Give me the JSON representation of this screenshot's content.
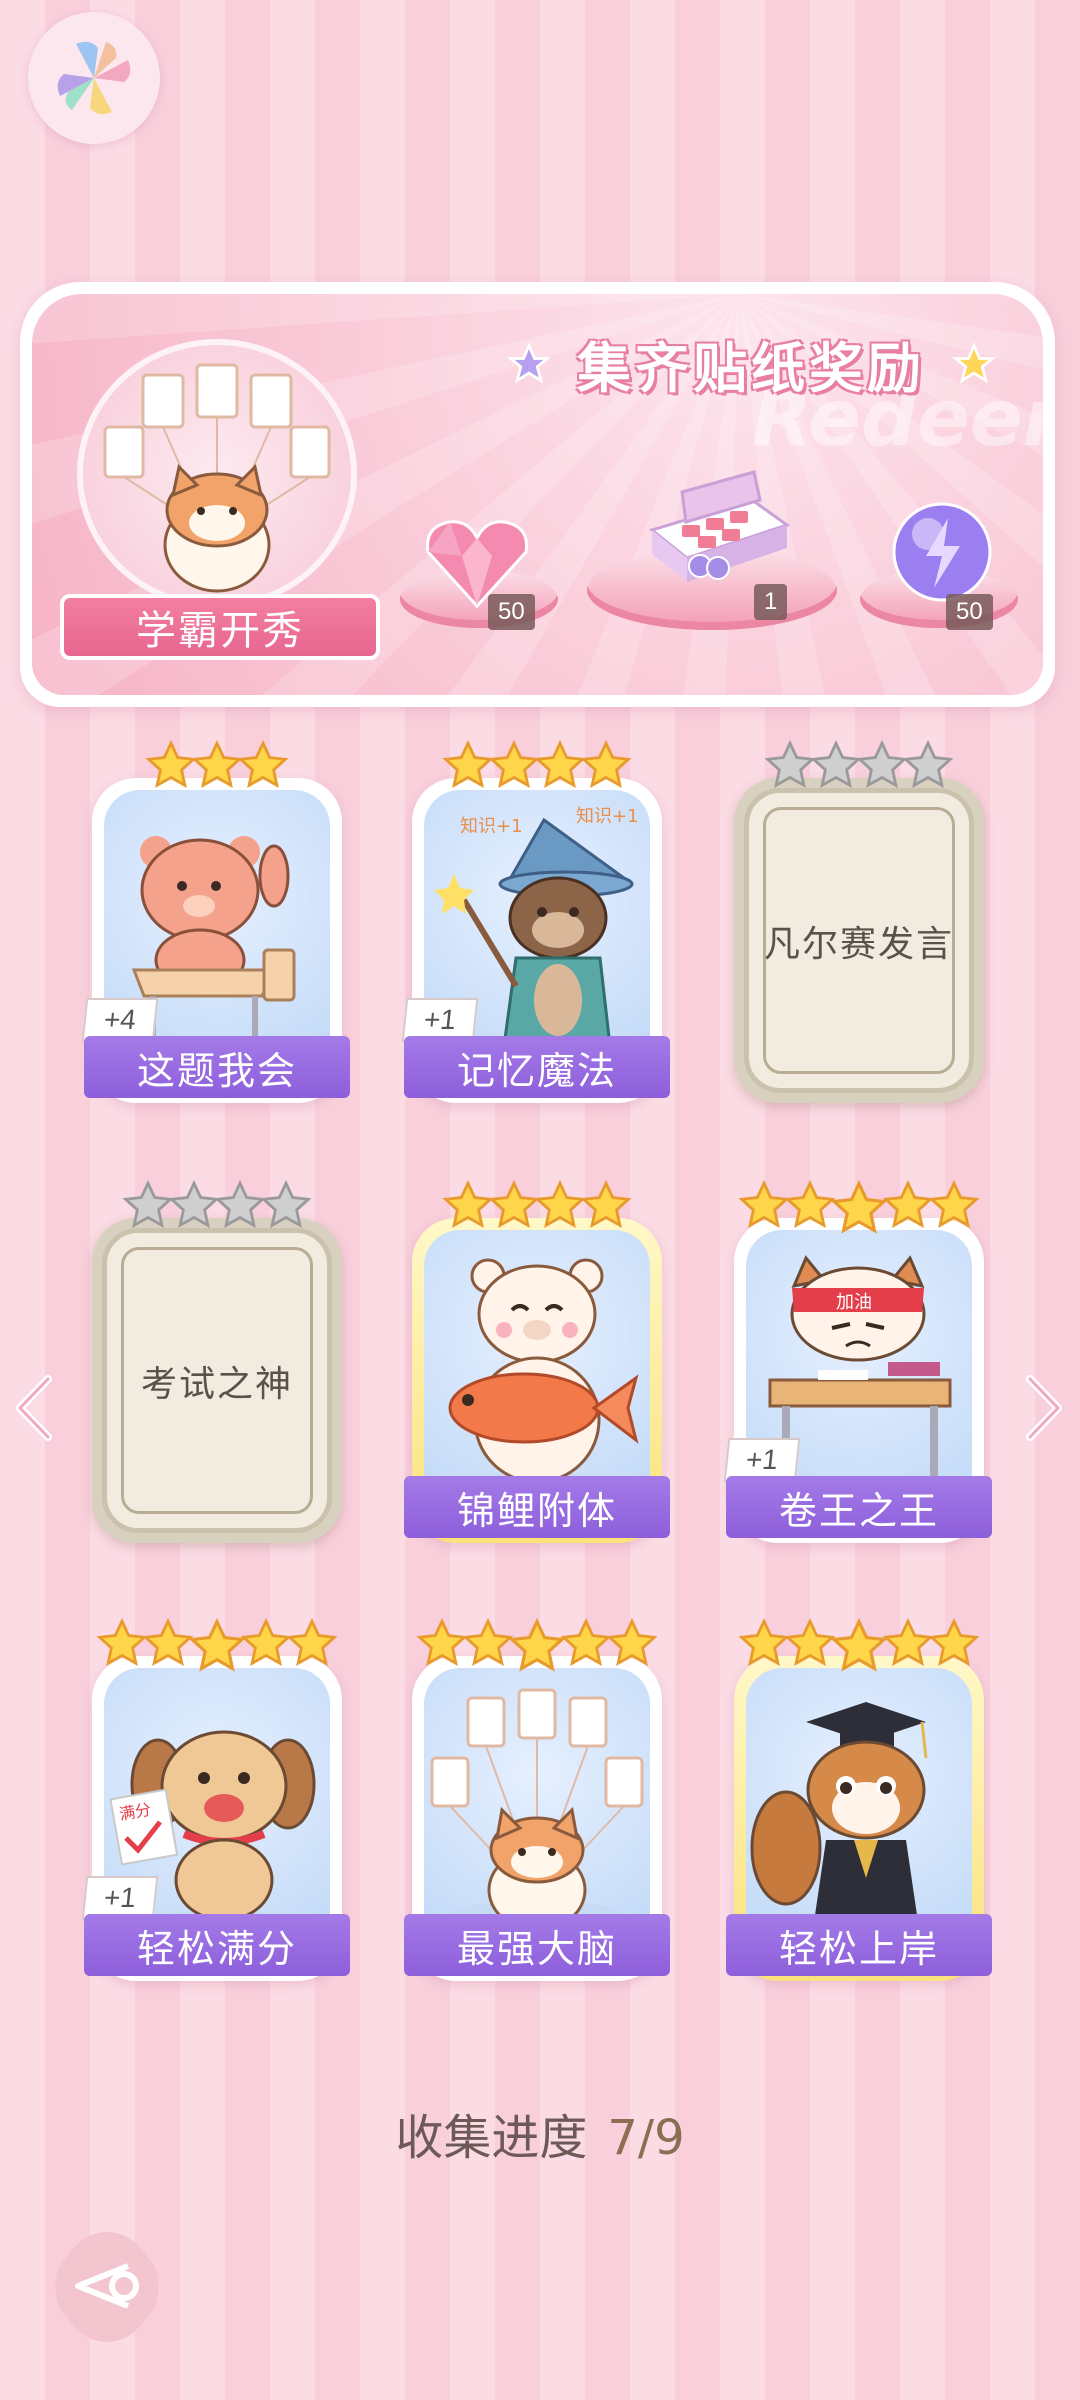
{
  "banner": {
    "title": "集齐贴纸奖励",
    "subtitle": "Redeem",
    "ribbon_label": "学霸开秀",
    "rewards": [
      {
        "icon": "pink-diamond-icon",
        "count": "50"
      },
      {
        "icon": "gift-box-icon",
        "count": "1"
      },
      {
        "icon": "lightning-orb-icon",
        "count": "50"
      }
    ]
  },
  "cards": [
    {
      "name": "这题我会",
      "stars": 3,
      "badge": "+4",
      "locked": false,
      "art": "bear-at-desk",
      "gold": false
    },
    {
      "name": "记忆魔法",
      "stars": 4,
      "badge": "+1",
      "locked": false,
      "art": "otter-wizard",
      "gold": false
    },
    {
      "name": "凡尔赛发言",
      "stars": 4,
      "badge": "",
      "locked": true,
      "art": "",
      "gold": false
    },
    {
      "name": "考试之神",
      "stars": 4,
      "badge": "",
      "locked": true,
      "art": "",
      "gold": false
    },
    {
      "name": "锦鲤附体",
      "stars": 4,
      "badge": "",
      "locked": false,
      "art": "bear-with-koi",
      "gold": true
    },
    {
      "name": "卷王之王",
      "stars": 5,
      "badge": "+1",
      "locked": false,
      "art": "cat-studying",
      "gold": false
    },
    {
      "name": "轻松满分",
      "stars": 5,
      "badge": "+1",
      "locked": false,
      "art": "puppy-full-score",
      "gold": false
    },
    {
      "name": "最强大脑",
      "stars": 5,
      "badge": "",
      "locked": false,
      "art": "cat-with-papers",
      "gold": false
    },
    {
      "name": "轻松上岸",
      "stars": 5,
      "badge": "",
      "locked": false,
      "art": "squirrel-graduate",
      "gold": true
    }
  ],
  "progress": {
    "label": "收集进度",
    "value": "7/9"
  }
}
